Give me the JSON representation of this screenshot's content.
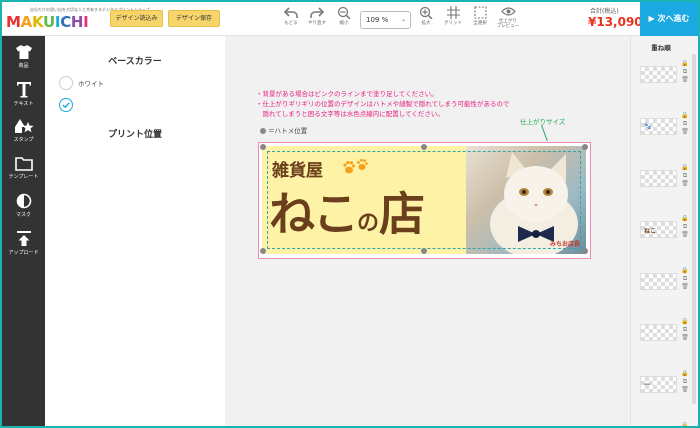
{
  "brand": {
    "tagline": "自分だけの思い出を大切な人と共有するデジタルプリントショップ",
    "logo_letters": [
      "M",
      "A",
      "K",
      "U",
      "I",
      "C",
      "H",
      "I"
    ],
    "logo_colors": [
      "#e6312f",
      "#f5a01a",
      "#f7d02c",
      "#5dbb46",
      "#1aa9e0",
      "#2f6fb8",
      "#8d4fa5",
      "#e6317e"
    ]
  },
  "toolbar": {
    "load_design": "デザイン読込み",
    "save_design": "デザイン保存",
    "undo": "もどる",
    "redo": "やり直す",
    "zoom_out": "縮小",
    "zoom_value": "109 %",
    "zoom_in": "拡大",
    "grid": "グリッド",
    "select_all": "全選択",
    "preview_line1": "仕上がり",
    "preview_line2": "プレビュー",
    "total_label": "合計(税込)",
    "total_price": "¥13,090",
    "next": "▶ 次へ進む"
  },
  "left_nav": [
    {
      "label": "商品",
      "icon": "tshirt-icon"
    },
    {
      "label": "テキスト",
      "icon": "text-icon"
    },
    {
      "label": "スタンプ",
      "icon": "stamp-icon"
    },
    {
      "label": "テンプレート",
      "icon": "folder-icon"
    },
    {
      "label": "マスク",
      "icon": "mask-icon"
    },
    {
      "label": "アップロード",
      "icon": "upload-icon"
    }
  ],
  "panel": {
    "base_color_title": "ベースカラー",
    "options": [
      {
        "label": "ホワイト",
        "checked": false
      },
      {
        "label": "",
        "checked": true
      }
    ],
    "print_position_title": "プリント位置"
  },
  "canvas": {
    "notes": [
      "・背景がある場合はピンクのラインまで塗り足してください。",
      "・仕上がりギリギリの位置のデザインはハトメや縫製で隠れてしまう可能性があるので",
      "　隠れてしまうと困る文字等は水色点線内に配置してください。"
    ],
    "eyelet_note": "＝ハトメ位置",
    "finish_size_label": "仕上がりサイズ",
    "banner": {
      "sub_title": "雑貨屋",
      "main_title": "ねこ",
      "main_title_small": "の",
      "main_title_end": "店",
      "photo_credit": "みちお店長",
      "text_color": "#6b3f1c",
      "bg_color": "#fdf2a6"
    }
  },
  "layers": {
    "title": "重ね順",
    "items": [
      {
        "thumb": ""
      },
      {
        "thumb": "🐾"
      },
      {
        "thumb": ""
      },
      {
        "thumb": "ねこ"
      },
      {
        "thumb": ""
      },
      {
        "thumb": ""
      },
      {
        "thumb": "—"
      },
      {
        "thumb": ""
      }
    ]
  }
}
